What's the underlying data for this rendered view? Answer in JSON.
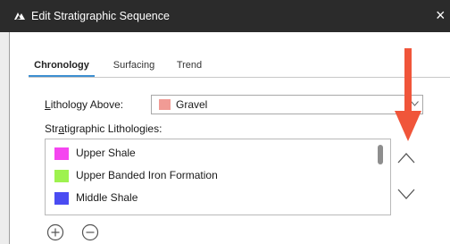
{
  "window": {
    "title": "Edit Stratigraphic Sequence",
    "close_label": "×"
  },
  "tabs": [
    {
      "label": "Chronology",
      "active": true
    },
    {
      "label": "Surfacing",
      "active": false
    },
    {
      "label": "Trend",
      "active": false
    }
  ],
  "lithology_above": {
    "label_key": "L",
    "label_rest": "ithology Above:",
    "selected_value": "Gravel",
    "selected_color": "#f19b95"
  },
  "stratigraphic_lithologies": {
    "label_pre": "Str",
    "label_key": "a",
    "label_rest": "tigraphic Lithologies:",
    "items": [
      {
        "label": "Upper Shale",
        "color": "#f545f0"
      },
      {
        "label": "Upper Banded Iron Formation",
        "color": "#9ef24f"
      },
      {
        "label": "Middle Shale",
        "color": "#4a4cf2"
      }
    ]
  },
  "colors": {
    "accent": "#3d8fd1",
    "annotation_arrow": "#f0553a"
  },
  "icons": {
    "move_up": "chevron-up-icon",
    "move_down": "chevron-down-icon",
    "add": "plus-circle-icon",
    "remove": "minus-circle-icon"
  }
}
